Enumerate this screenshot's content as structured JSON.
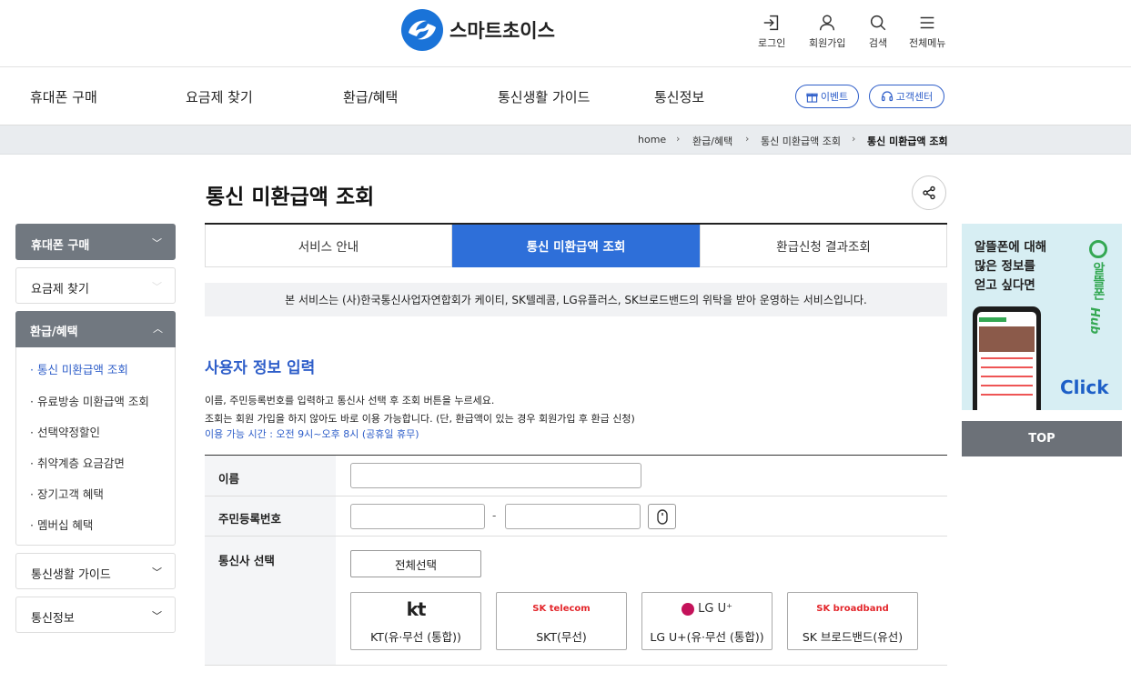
{
  "header": {
    "logo_text": "스마트초이스",
    "utils": [
      {
        "label": "로그인",
        "icon": "login-icon"
      },
      {
        "label": "회원가입",
        "icon": "user-icon"
      },
      {
        "label": "검색",
        "icon": "search-icon"
      },
      {
        "label": "전체메뉴",
        "icon": "menu-icon"
      }
    ]
  },
  "nav": {
    "items": [
      "휴대폰 구매",
      "요금제 찾기",
      "환급/혜택",
      "통신생활 가이드",
      "통신정보"
    ],
    "event_label": "이벤트",
    "support_label": "고객센터"
  },
  "breadcrumb": [
    "home",
    "환급/혜택",
    "통신 미환급액 조회",
    "통신 미환급액 조회"
  ],
  "sidebar": {
    "groups": [
      {
        "label": "휴대폰 구매",
        "chevron": "⌄"
      },
      {
        "label": "요금제 찾기",
        "chevron": "⌄"
      },
      {
        "label": "환급/혜택",
        "chevron": "⌃"
      },
      {
        "label": "통신생활 가이드",
        "chevron": "⌄"
      },
      {
        "label": "통신정보",
        "chevron": "⌄"
      }
    ],
    "subitems": [
      "통신 미환급액 조회",
      "유료방송 미환급액 조회",
      "선택약정할인",
      "취약계층 요금감면",
      "장기고객 혜택",
      "멤버십 혜택"
    ],
    "bullet": "·"
  },
  "page": {
    "title": "통신 미환급액 조회",
    "tabs": [
      "서비스 안내",
      "통신 미환급액 조회",
      "환급신청 결과조회"
    ],
    "notice": "본 서비스는 (사)한국통신사업자연합회가 케이티, SK텔레콤, LG유플러스, SK브로드밴드의 위탁을 받아 운영하는 서비스입니다.",
    "section_title": "사용자 정보 입력",
    "desc1": "이름, 주민등록번호를 입력하고 통신사 선택 후 조회 버튼을 누르세요.",
    "desc2": "조회는 회원 가입을 하지 않아도 바로 이용 가능합니다. (단, 환급액이 있는 경우 회원가입 후 환급 신청)",
    "desc3": "이용 가능 시간 : 오전 9시~오후 8시 (공휴일 휴무)"
  },
  "form": {
    "name_label": "이름",
    "name_value": "",
    "rrn_label": "주민등록번호",
    "rrn_front": "",
    "rrn_back": "",
    "rrn_dash": "-",
    "carrier_label": "통신사 선택",
    "select_all": "전체선택",
    "carriers": [
      {
        "logo": "kt",
        "name": "KT(유·무선 (통합))"
      },
      {
        "logo": "SK telecom",
        "name": "SKT(무선)"
      },
      {
        "logo": "LG U⁺",
        "name": "LG U+(유·무선 (통합))"
      },
      {
        "logo": "SK broadband",
        "name": "SK 브로드밴드(유선)"
      }
    ]
  },
  "banner": {
    "line1": "알뜰폰에 대해",
    "line2": "많은 정보를",
    "line3": "얻고 싶다면",
    "brand": "알뜰폰",
    "brand_hub": "Hub",
    "click": "Click"
  },
  "top_button": "TOP",
  "colors": {
    "accent": "#2e6fd9",
    "link": "#2e5ec9",
    "sidebar_dark": "#717880"
  }
}
